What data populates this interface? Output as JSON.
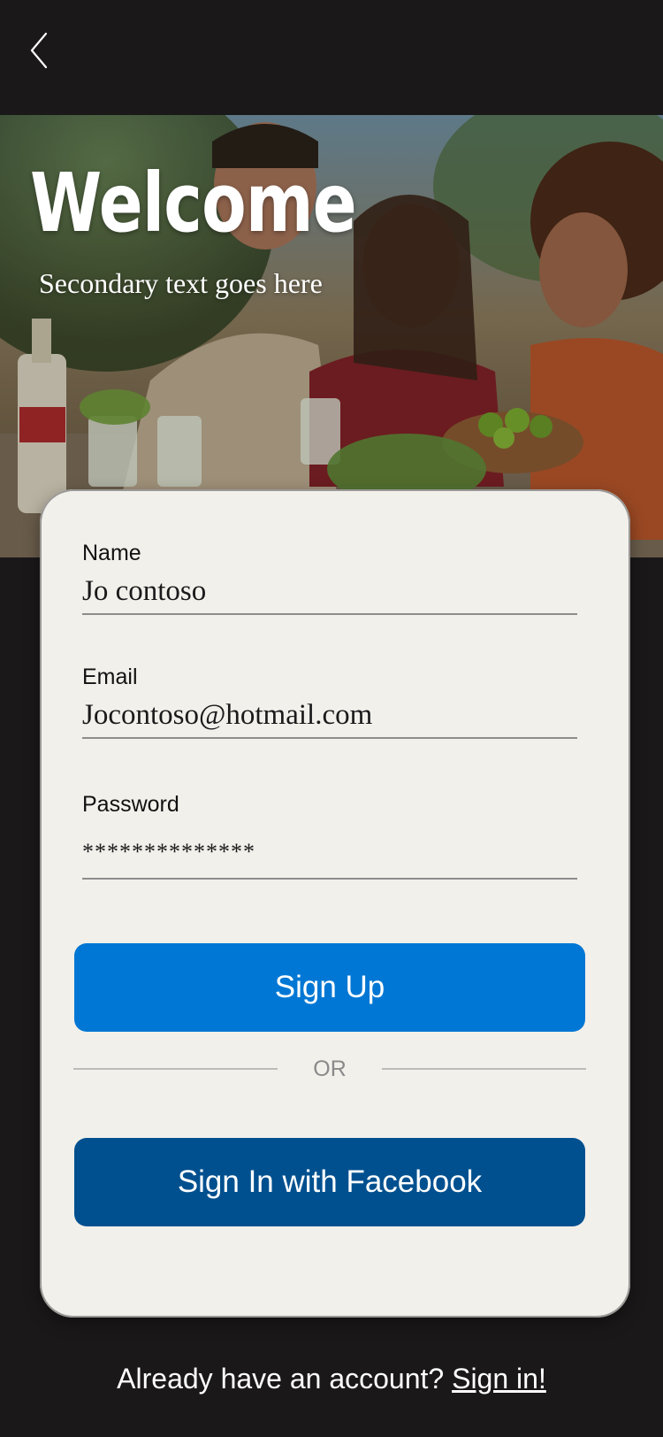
{
  "header": {
    "back_icon": "chevron-left-icon"
  },
  "hero": {
    "title": "Welcome",
    "subtitle": "Secondary text goes here"
  },
  "form": {
    "name": {
      "label": "Name",
      "value": "Jo contoso"
    },
    "email": {
      "label": "Email",
      "value": "Jocontoso@hotmail.com"
    },
    "password": {
      "label": "Password",
      "value": "**************"
    },
    "signup_label": "Sign Up",
    "divider_text": "OR",
    "facebook_label": "Sign In with Facebook"
  },
  "footer": {
    "prompt": "Already have an account?",
    "link": "Sign in!"
  },
  "colors": {
    "background": "#1a1819",
    "card": "#f2f0eb",
    "signup_button": "#0077d4",
    "facebook_button": "#00508f"
  }
}
